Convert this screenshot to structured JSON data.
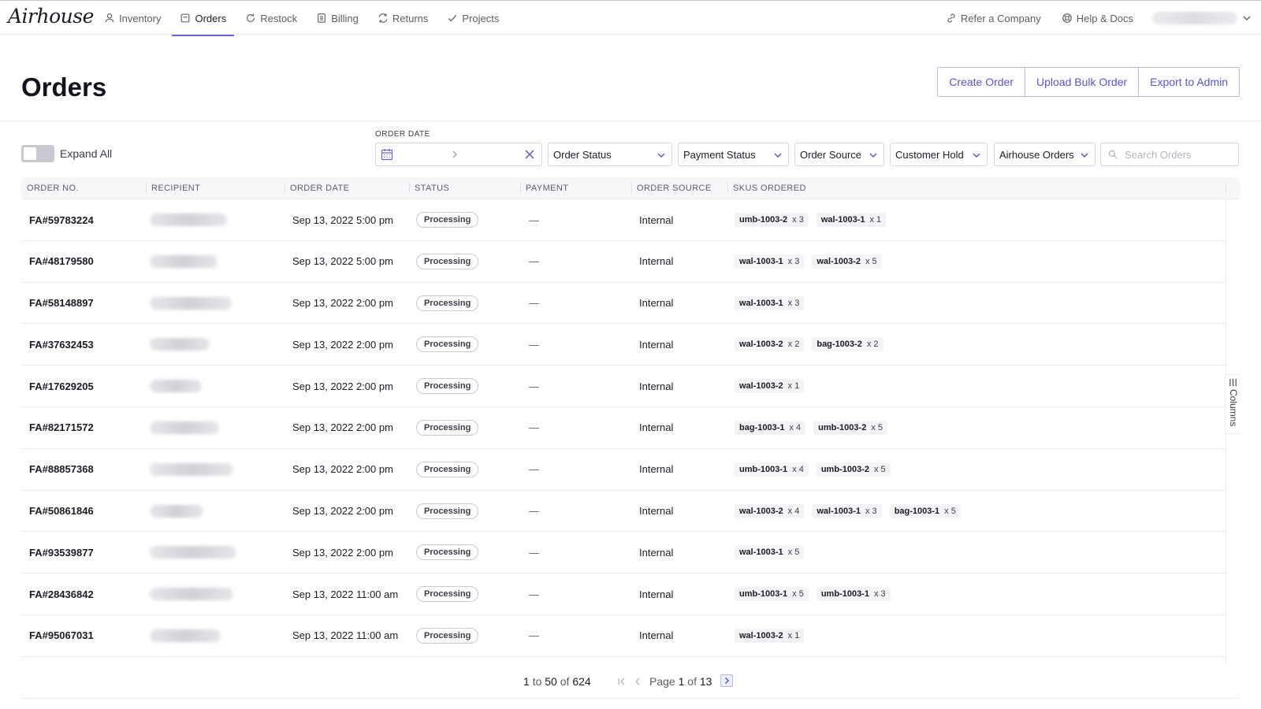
{
  "brand": "Airhouse",
  "nav": {
    "items": [
      {
        "label": "Inventory"
      },
      {
        "label": "Orders"
      },
      {
        "label": "Restock"
      },
      {
        "label": "Billing"
      },
      {
        "label": "Returns"
      },
      {
        "label": "Projects"
      }
    ],
    "active": "Orders",
    "right": [
      {
        "label": "Refer a Company"
      },
      {
        "label": "Help & Docs"
      }
    ]
  },
  "page": {
    "title": "Orders",
    "actions": {
      "create": "Create Order",
      "bulk": "Upload Bulk Order",
      "export": "Export to Admin"
    }
  },
  "filters": {
    "expand_all": "Expand All",
    "expand_all_on": false,
    "order_date_label": "ORDER DATE",
    "selects": [
      {
        "label": "Order Status"
      },
      {
        "label": "Payment Status"
      },
      {
        "label": "Order Source"
      },
      {
        "label": "Customer Hold"
      },
      {
        "label": "Airhouse Orders"
      }
    ],
    "search_placeholder": "Search Orders"
  },
  "table": {
    "columns": [
      "ORDER NO.",
      "RECIPIENT",
      "ORDER DATE",
      "STATUS",
      "PAYMENT",
      "ORDER SOURCE",
      "SKUS ORDERED"
    ],
    "rows": [
      {
        "no": "FA#59783224",
        "date": "Sep 13, 2022 5:00 pm",
        "status": "Processing",
        "payment": "—",
        "source": "Internal",
        "skus": [
          {
            "sku": "umb-1003-2",
            "qty": "x 3"
          },
          {
            "sku": "wal-1003-1",
            "qty": "x 1"
          }
        ]
      },
      {
        "no": "FA#48179580",
        "date": "Sep 13, 2022 5:00 pm",
        "status": "Processing",
        "payment": "—",
        "source": "Internal",
        "skus": [
          {
            "sku": "wal-1003-1",
            "qty": "x 3"
          },
          {
            "sku": "wal-1003-2",
            "qty": "x 5"
          }
        ]
      },
      {
        "no": "FA#58148897",
        "date": "Sep 13, 2022 2:00 pm",
        "status": "Processing",
        "payment": "—",
        "source": "Internal",
        "skus": [
          {
            "sku": "wal-1003-1",
            "qty": "x 3"
          }
        ]
      },
      {
        "no": "FA#37632453",
        "date": "Sep 13, 2022 2:00 pm",
        "status": "Processing",
        "payment": "—",
        "source": "Internal",
        "skus": [
          {
            "sku": "wal-1003-2",
            "qty": "x 2"
          },
          {
            "sku": "bag-1003-2",
            "qty": "x 2"
          }
        ]
      },
      {
        "no": "FA#17629205",
        "date": "Sep 13, 2022 2:00 pm",
        "status": "Processing",
        "payment": "—",
        "source": "Internal",
        "skus": [
          {
            "sku": "wal-1003-2",
            "qty": "x 1"
          }
        ]
      },
      {
        "no": "FA#82171572",
        "date": "Sep 13, 2022 2:00 pm",
        "status": "Processing",
        "payment": "—",
        "source": "Internal",
        "skus": [
          {
            "sku": "bag-1003-1",
            "qty": "x 4"
          },
          {
            "sku": "umb-1003-2",
            "qty": "x 5"
          }
        ]
      },
      {
        "no": "FA#88857368",
        "date": "Sep 13, 2022 2:00 pm",
        "status": "Processing",
        "payment": "—",
        "source": "Internal",
        "skus": [
          {
            "sku": "umb-1003-1",
            "qty": "x 4"
          },
          {
            "sku": "umb-1003-2",
            "qty": "x 5"
          }
        ]
      },
      {
        "no": "FA#50861846",
        "date": "Sep 13, 2022 2:00 pm",
        "status": "Processing",
        "payment": "—",
        "source": "Internal",
        "skus": [
          {
            "sku": "wal-1003-2",
            "qty": "x 4"
          },
          {
            "sku": "wal-1003-1",
            "qty": "x 3"
          },
          {
            "sku": "bag-1003-1",
            "qty": "x 5"
          }
        ]
      },
      {
        "no": "FA#93539877",
        "date": "Sep 13, 2022 2:00 pm",
        "status": "Processing",
        "payment": "—",
        "source": "Internal",
        "skus": [
          {
            "sku": "wal-1003-1",
            "qty": "x 5"
          }
        ]
      },
      {
        "no": "FA#28436842",
        "date": "Sep 13, 2022 11:00 am",
        "status": "Processing",
        "payment": "—",
        "source": "Internal",
        "skus": [
          {
            "sku": "umb-1003-1",
            "qty": "x 5"
          },
          {
            "sku": "umb-1003-1",
            "qty": "x 3"
          }
        ]
      },
      {
        "no": "FA#95067031",
        "date": "Sep 13, 2022 11:00 am",
        "status": "Processing",
        "payment": "—",
        "source": "Internal",
        "skus": [
          {
            "sku": "wal-1003-2",
            "qty": "x 1"
          }
        ]
      }
    ],
    "columns_tab": "Columns"
  },
  "pagination": {
    "from": "1",
    "to_word": "to",
    "to": "50",
    "of_word": "of",
    "total": "624",
    "page_word": "Page",
    "page": "1",
    "page_of_word": "of",
    "pages": "13"
  },
  "colors": {
    "accent": "#5a54d6",
    "border": "#d6d6de",
    "badge_border": "#c9c9d1"
  },
  "icons": {
    "nav": [
      "person-icon",
      "orders-box-icon",
      "restock-icon",
      "billing-icon",
      "returns-icon",
      "check-icon"
    ],
    "right": [
      "link-icon",
      "lifebuoy-icon"
    ]
  }
}
